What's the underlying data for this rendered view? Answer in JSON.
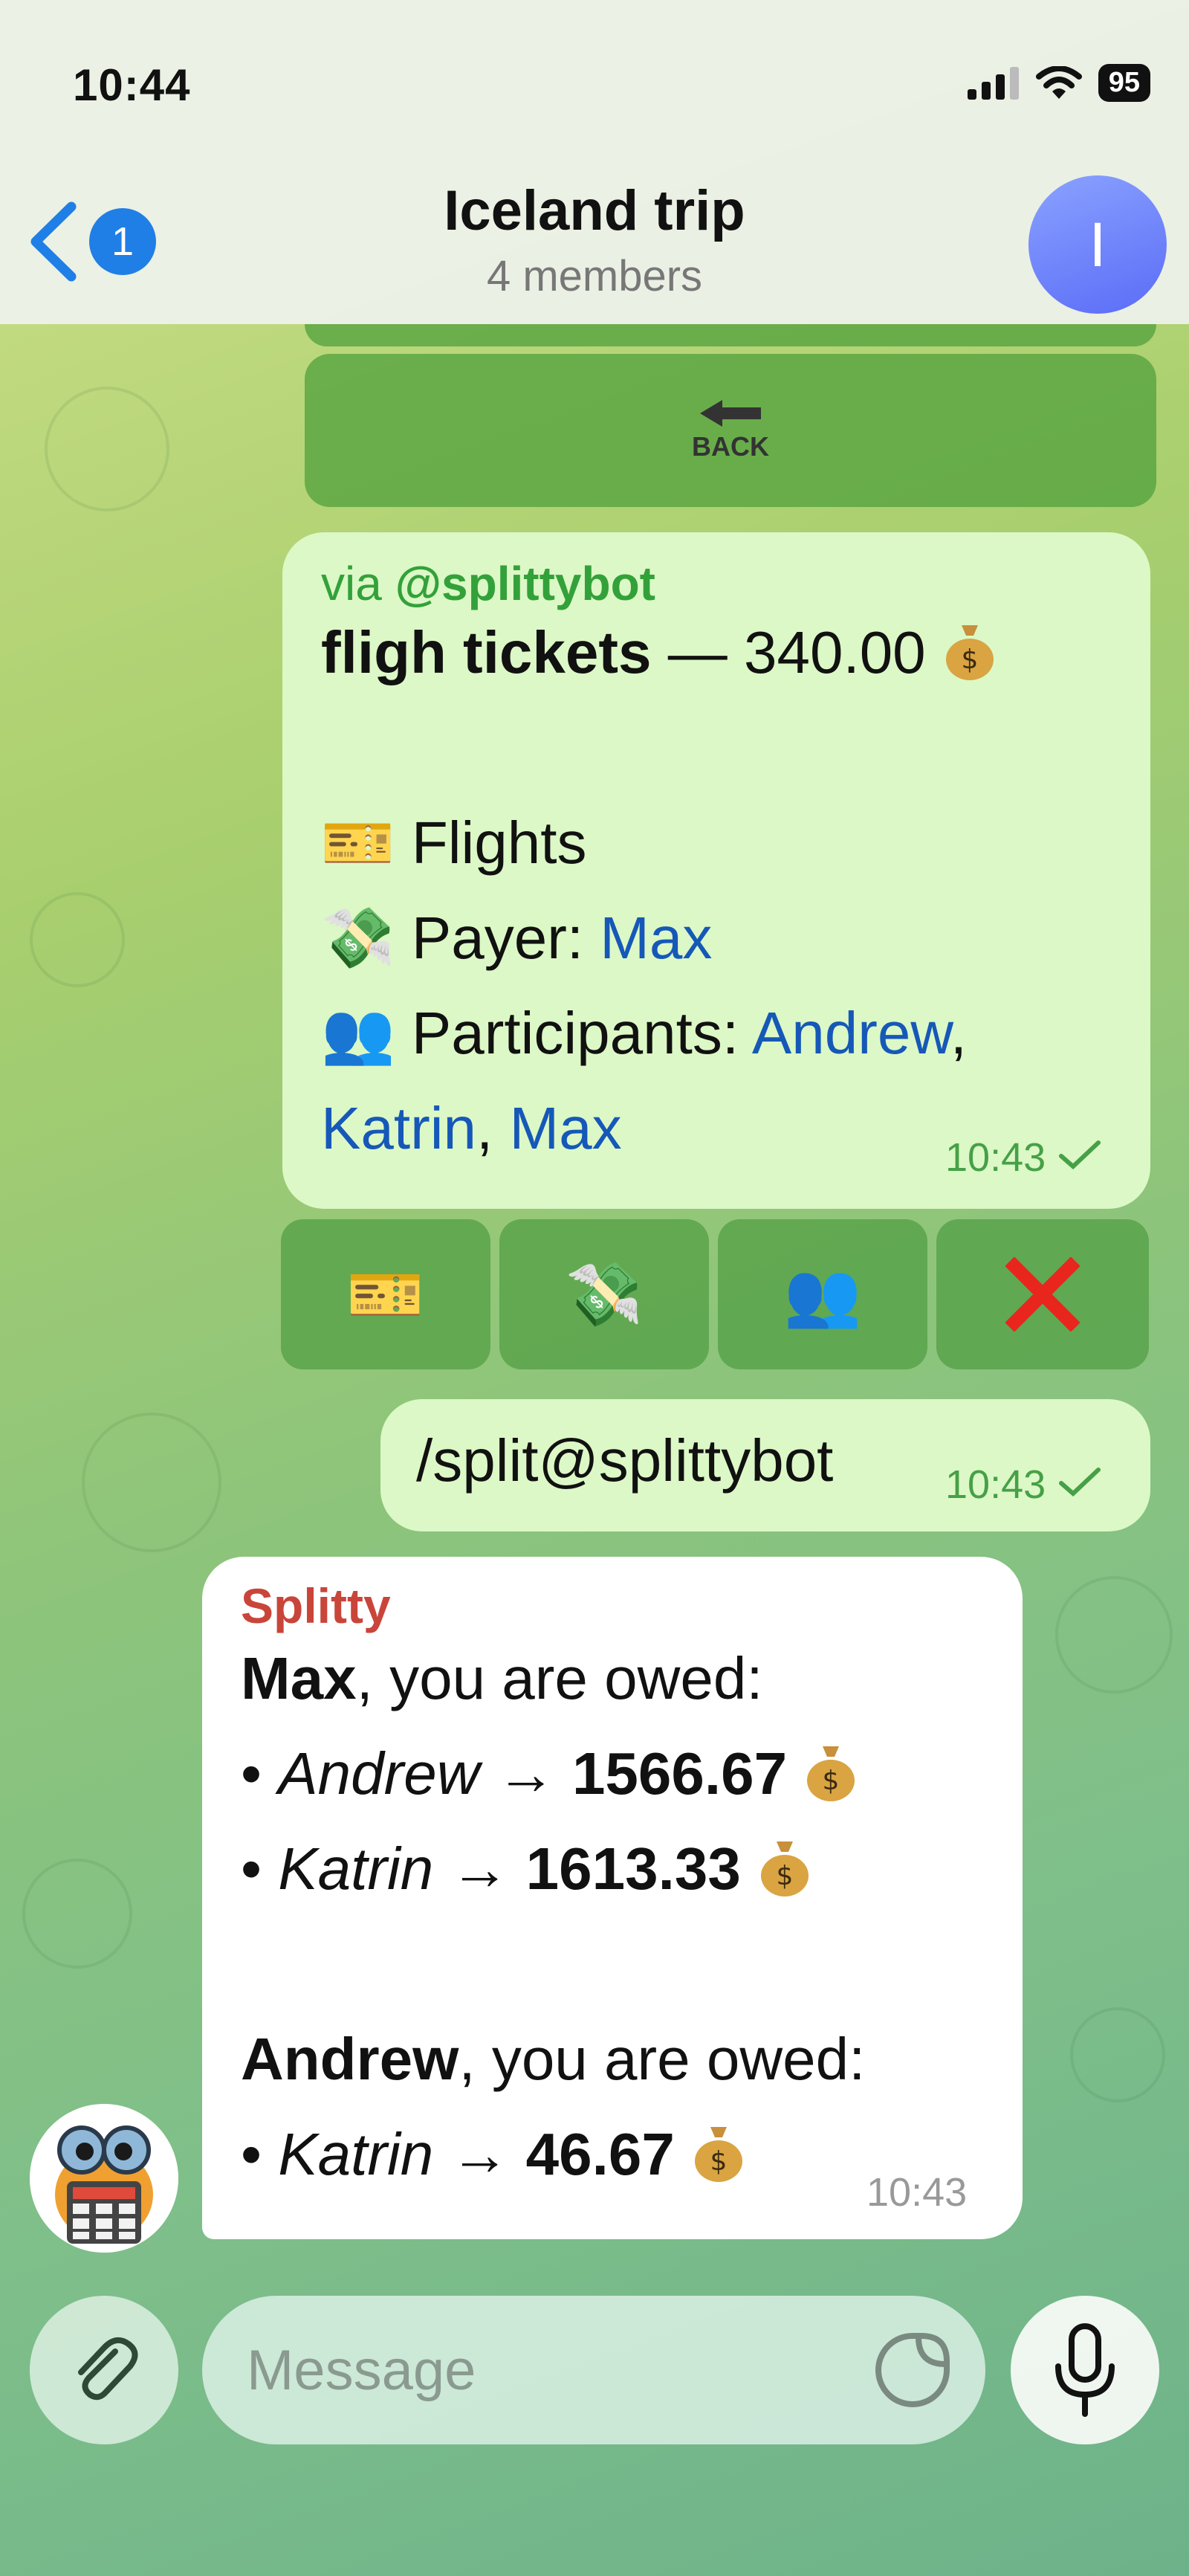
{
  "status_bar": {
    "time": "10:44",
    "battery": "95"
  },
  "header": {
    "back_badge": "1",
    "title": "Iceland trip",
    "subtitle": "4 members",
    "avatar_letter": "I"
  },
  "top_keyboard": {
    "back_label": "BACK"
  },
  "expense_message": {
    "via_prefix": "via ",
    "via_bot": "@splittybot",
    "title_bold": "fligh tickets",
    "title_rest": " — 340.00",
    "category_emoji": "🎫",
    "category": "Flights",
    "payer_emoji": "💸",
    "payer_label": "Payer: ",
    "payer_name": "Max",
    "participants_emoji": "👥",
    "participants_label": "Participants: ",
    "participants": [
      "Andrew",
      "Katrin",
      "Max"
    ],
    "time": "10:43"
  },
  "inline_buttons": [
    {
      "icon": "ticket-icon",
      "emoji": "🎫"
    },
    {
      "icon": "money-wings-icon",
      "emoji": "💸"
    },
    {
      "icon": "people-icon",
      "emoji": "👥"
    },
    {
      "icon": "cross-mark-icon",
      "emoji": "❌"
    }
  ],
  "command_message": {
    "text": "/split@splittybot",
    "time": "10:43"
  },
  "bot_message": {
    "sender": "Splitty",
    "block1_name": "Max",
    "block1_text": ", you are owed:",
    "debts1": [
      {
        "name": "Andrew",
        "amount": "1566.67"
      },
      {
        "name": "Katrin",
        "amount": "1613.33"
      }
    ],
    "block2_name": "Andrew",
    "block2_text": ", you are owed:",
    "debts2": [
      {
        "name": "Katrin",
        "amount": "46.67"
      }
    ],
    "time": "10:43"
  },
  "composer": {
    "placeholder": "Message"
  }
}
